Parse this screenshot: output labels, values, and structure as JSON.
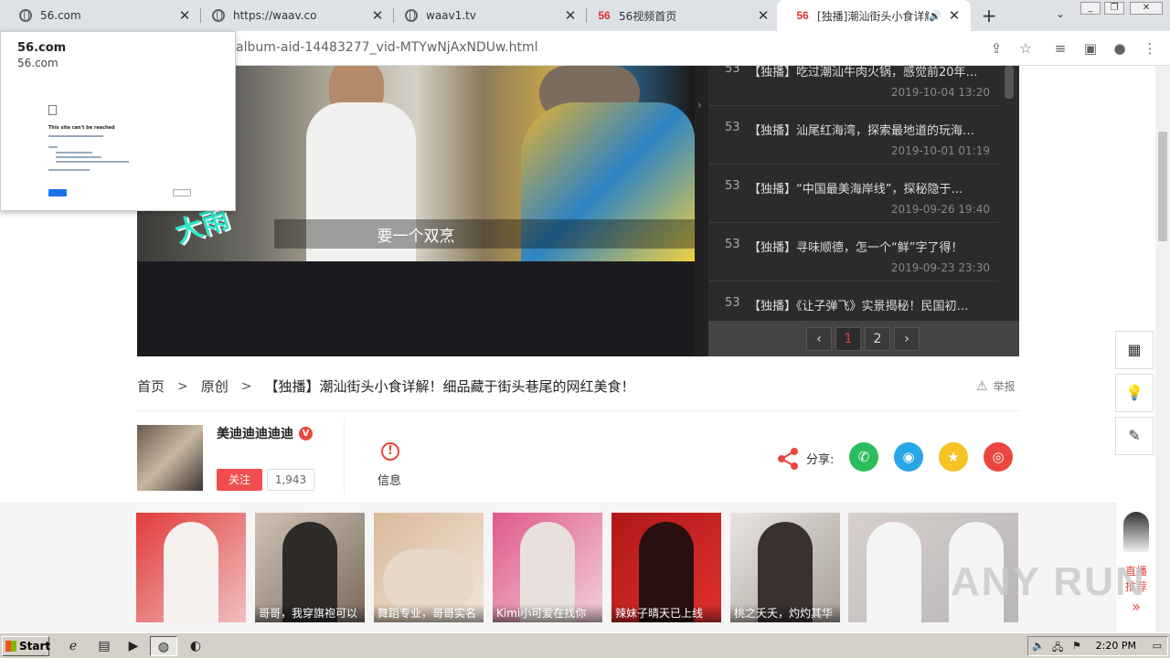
{
  "tabs": [
    {
      "title": "56.com",
      "favicon": "globe-icon"
    },
    {
      "title": "https://waav.co",
      "favicon": "globe-icon"
    },
    {
      "title": "waav1.tv",
      "favicon": "globe-icon"
    },
    {
      "title": "56视频首页",
      "favicon": "56-logo"
    },
    {
      "title": "[独播]潮汕街头小食详解",
      "favicon": "56-logo"
    }
  ],
  "logo56": "56",
  "address": {
    "url": "album-aid-14483277_vid-MTYwNjAxNDUw.html"
  },
  "hover_card": {
    "title": "56.com",
    "domain": "56.com",
    "thumb_heading": "This site can't be reached"
  },
  "player": {
    "subtitle": "要一个双烹",
    "logo_text": "大雨"
  },
  "playlist": {
    "items": [
      {
        "num": "53",
        "title": "【独播】吃过潮汕牛肉火锅，感觉前20年…",
        "date": "2019-10-04 13:20"
      },
      {
        "num": "53",
        "title": "【独播】汕尾红海湾，探索最地道的玩海…",
        "date": "2019-10-01 01:19"
      },
      {
        "num": "53",
        "title": "【独播】“中国最美海岸线”，探秘隐于…",
        "date": "2019-09-26 19:40"
      },
      {
        "num": "53",
        "title": "【独播】寻味顺德，怎一个“鲜”字了得！",
        "date": "2019-09-23 23:30"
      },
      {
        "num": "53",
        "title": "【独播】《让子弹飞》实景揭秘！民国初…",
        "date": ""
      }
    ],
    "pager": {
      "prev": "‹",
      "pages": [
        "1",
        "2"
      ],
      "next": "›",
      "current": "1"
    }
  },
  "breadcrumb": {
    "home": "首页",
    "category": "原创",
    "sep": ">",
    "title": "【独播】潮汕街头小食详解！细品藏于街头巷尾的网红美食！"
  },
  "report_label": "举报",
  "uploader": {
    "name": "美迪迪迪迪迪",
    "badge": "V",
    "follow_label": "关注",
    "fans": "1,943"
  },
  "info": {
    "label": "信息",
    "icon": "!"
  },
  "share": {
    "label": "分享:"
  },
  "recommend": [
    {
      "caption": ""
    },
    {
      "caption": "哥哥，我穿旗袍可以"
    },
    {
      "caption": "舞蹈专业，哥哥实名"
    },
    {
      "caption": "Kimi小可爱在找你"
    },
    {
      "caption": "辣妹子晴天已上线"
    },
    {
      "caption": "桃之夭夭，灼灼其华"
    },
    {
      "caption": ""
    }
  ],
  "live": {
    "line1": "直播",
    "line2": "推荐",
    "arrow": "»"
  },
  "watermark": "ANY RUN",
  "taskbar": {
    "start": "Start",
    "clock": "2:20 PM"
  },
  "colors": {
    "brand_red": "#e0312d",
    "accent_red": "#f04e4e",
    "wechat": "#2bbd5c",
    "qq": "#27a7e8",
    "qzone": "#f7c325",
    "weibo": "#e8463e"
  }
}
